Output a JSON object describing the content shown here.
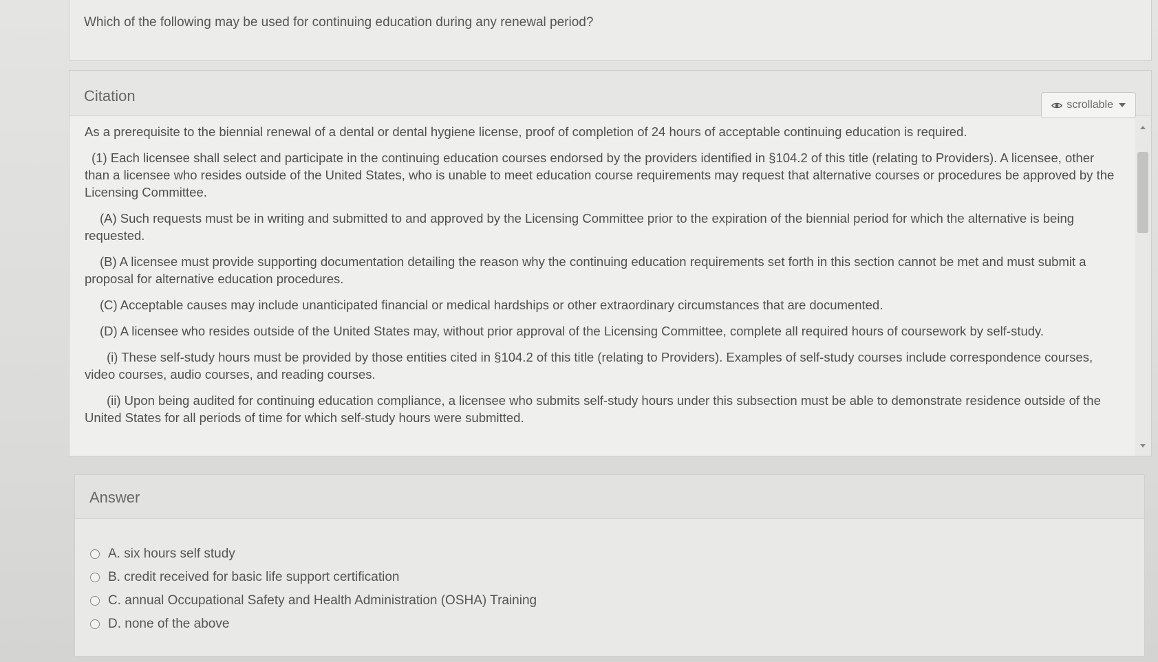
{
  "question": {
    "text": "Which of the following may be used for continuing education during any renewal period?"
  },
  "citation": {
    "title": "Citation",
    "toggle_label": "scrollable",
    "toggle_icon": "eye-icon",
    "paragraphs": [
      "As a prerequisite to the biennial renewal of a dental or dental hygiene license, proof of completion of 24 hours of acceptable continuing education is required.",
      "(1) Each licensee shall select and participate in the continuing education courses endorsed by the providers identified in §104.2 of this title (relating to Providers). A licensee, other than a licensee who resides outside of the United States, who is unable to meet education course requirements may request that alternative courses or procedures be approved by the Licensing Committee.",
      "(A) Such requests must be in writing and submitted to and approved by the Licensing Committee prior to the expiration of the biennial period for which the alternative is being requested.",
      "(B) A licensee must provide supporting documentation detailing the reason why the continuing education requirements set forth in this section cannot be met and must submit a proposal for alternative education procedures.",
      "(C) Acceptable causes may include unanticipated financial or medical hardships or other extraordinary circumstances that are documented.",
      "(D) A licensee who resides outside of the United States may, without prior approval of the Licensing Committee, complete all required hours of coursework by self-study.",
      "(i) These self-study hours must be provided by those entities cited in §104.2 of this title (relating to Providers). Examples of self-study courses include correspondence courses, video courses, audio courses, and reading courses.",
      "(ii) Upon being audited for continuing education compliance, a licensee who submits self-study hours under this subsection must be able to demonstrate residence outside of the United States for all periods of time for which self-study hours were submitted."
    ]
  },
  "answer": {
    "title": "Answer",
    "options": [
      "A. six hours self study",
      "B. credit received for basic life support certification",
      "C. annual Occupational Safety and Health Administration (OSHA) Training",
      "D. none of the above"
    ]
  }
}
